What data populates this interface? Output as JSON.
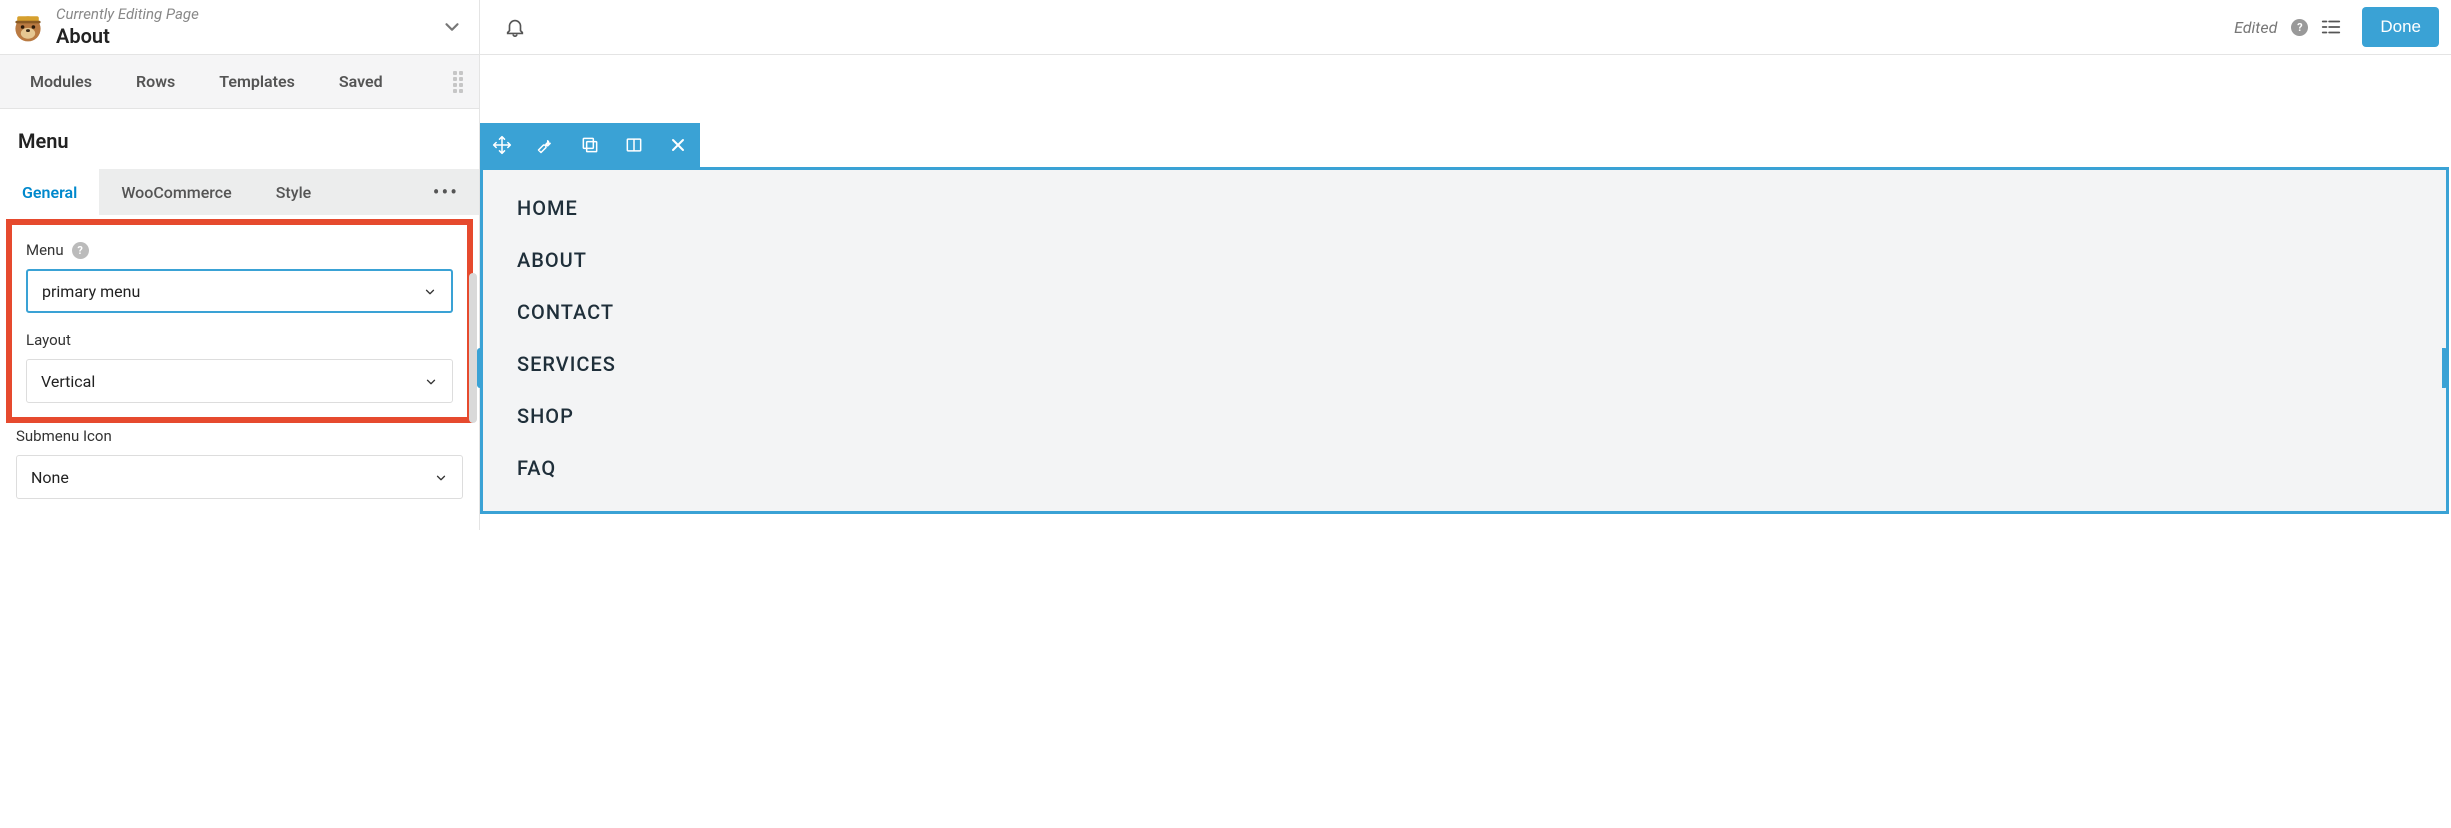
{
  "header": {
    "editing_label": "Currently Editing Page",
    "page_title": "About"
  },
  "sidebar_tabs": [
    "Modules",
    "Rows",
    "Templates",
    "Saved"
  ],
  "module_title": "Menu",
  "module_tabs": {
    "active": "General",
    "items": [
      "General",
      "WooCommerce",
      "Style"
    ]
  },
  "fields": {
    "menu_label": "Menu",
    "menu_value": "primary menu",
    "layout_label": "Layout",
    "layout_value": "Vertical",
    "submenu_label": "Submenu Icon",
    "submenu_value": "None"
  },
  "topbar": {
    "edited_label": "Edited",
    "done_label": "Done"
  },
  "preview_menu": [
    "HOME",
    "ABOUT",
    "CONTACT",
    "SERVICES",
    "SHOP",
    "FAQ"
  ]
}
